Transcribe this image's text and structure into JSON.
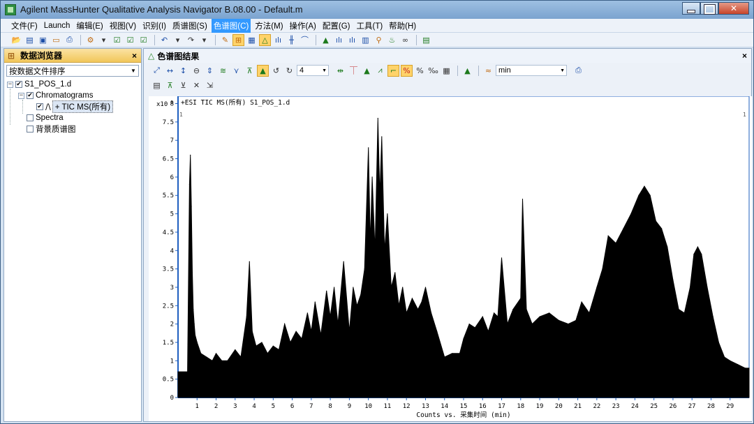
{
  "window": {
    "title": "Agilent MassHunter Qualitative Analysis Navigator B.08.00 - Default.m"
  },
  "menu": [
    "文件(F)",
    "Launch",
    "编辑(E)",
    "视图(V)",
    "识别(I)",
    "质谱图(S)",
    "色谱图(C)",
    "方法(M)",
    "操作(A)",
    "配置(G)",
    "工具(T)",
    "帮助(H)"
  ],
  "menu_active_index": 6,
  "left_panel": {
    "title": "数据浏览器",
    "close": "×",
    "sort_label": "按数据文件排序",
    "tree": {
      "file": "S1_POS_1.d",
      "chromatograms": "Chromatograms",
      "tic": "+ TIC MS(所有)",
      "spectra": "Spectra",
      "background": "背景质谱图"
    }
  },
  "right_panel": {
    "title": "色谱图结果",
    "close": "×",
    "count_value": "4",
    "unit_value": "min"
  },
  "chart_data": {
    "type": "line",
    "title": "+ESI TIC MS(所有) S1_POS_1.d",
    "y_multiplier": "x10",
    "y_exponent": "6",
    "ylim": [
      0,
      8.2
    ],
    "xlim": [
      0,
      30
    ],
    "y_ticks": [
      0,
      0.5,
      1,
      1.5,
      2,
      2.5,
      3,
      3.5,
      4,
      4.5,
      5,
      5.5,
      6,
      6.5,
      7,
      7.5,
      8
    ],
    "y_tick_labels": [
      "0",
      "0.5",
      "1",
      "1.5",
      "2",
      "2.5",
      "3",
      "3.5",
      "4",
      "4.5",
      "5",
      "5.5",
      "6",
      "6.5",
      "7",
      "7.5",
      "8"
    ],
    "x_ticks": [
      1,
      2,
      3,
      4,
      5,
      6,
      7,
      8,
      9,
      10,
      11,
      12,
      13,
      14,
      15,
      16,
      17,
      18,
      19,
      20,
      21,
      22,
      23,
      24,
      25,
      26,
      27,
      28,
      29
    ],
    "x_tick_labels": [
      "1",
      "2",
      "3",
      "4",
      "5",
      "6",
      "7",
      "8",
      "9",
      "10",
      "11",
      "12",
      "13",
      "14",
      "15",
      "16",
      "17",
      "18",
      "19",
      "20",
      "21",
      "22",
      "23",
      "24",
      "25",
      "26",
      "27",
      "28",
      "29"
    ],
    "xlabel": "Counts vs. 采集时间 (min)",
    "corner_labels": [
      "1",
      "1"
    ],
    "series": [
      {
        "color": "#000000",
        "x": [
          0.0,
          0.5,
          0.6,
          0.65,
          0.7,
          0.75,
          0.8,
          0.85,
          0.9,
          1.0,
          1.2,
          1.5,
          1.8,
          2.0,
          2.3,
          2.6,
          3.0,
          3.3,
          3.6,
          3.75,
          3.9,
          4.1,
          4.4,
          4.7,
          5.0,
          5.3,
          5.6,
          5.9,
          6.2,
          6.5,
          6.8,
          7.0,
          7.2,
          7.5,
          7.8,
          8.0,
          8.2,
          8.4,
          8.7,
          9.0,
          9.2,
          9.4,
          9.6,
          9.8,
          10.0,
          10.1,
          10.2,
          10.35,
          10.5,
          10.6,
          10.7,
          10.85,
          11.0,
          11.2,
          11.4,
          11.6,
          11.8,
          12.0,
          12.3,
          12.6,
          12.8,
          13.0,
          13.3,
          13.6,
          14.0,
          14.4,
          14.8,
          15.0,
          15.3,
          15.6,
          16.0,
          16.3,
          16.6,
          16.8,
          17.0,
          17.3,
          17.6,
          18.0,
          18.1,
          18.3,
          18.6,
          19.0,
          19.5,
          20.0,
          20.5,
          20.9,
          21.2,
          21.6,
          22.0,
          22.3,
          22.6,
          23.0,
          23.4,
          23.8,
          24.2,
          24.5,
          24.8,
          25.1,
          25.4,
          25.7,
          26.0,
          26.3,
          26.6,
          26.9,
          27.1,
          27.3,
          27.5,
          27.8,
          28.1,
          28.4,
          28.7,
          29.0,
          29.4,
          29.8,
          30.0
        ],
        "y": [
          0.7,
          0.7,
          5.8,
          6.6,
          5.2,
          3.4,
          2.4,
          2.0,
          1.7,
          1.5,
          1.2,
          1.1,
          1.0,
          1.2,
          1.0,
          1.0,
          1.3,
          1.1,
          2.2,
          3.7,
          1.8,
          1.4,
          1.5,
          1.2,
          1.4,
          1.3,
          2.0,
          1.5,
          1.8,
          1.6,
          2.3,
          1.8,
          2.6,
          1.7,
          2.9,
          2.2,
          3.0,
          2.0,
          3.7,
          1.8,
          3.0,
          2.5,
          2.8,
          3.5,
          6.8,
          4.2,
          6.0,
          4.0,
          7.6,
          5.5,
          7.1,
          4.0,
          5.0,
          3.0,
          3.4,
          2.5,
          3.0,
          2.3,
          2.7,
          2.4,
          2.6,
          3.0,
          2.3,
          1.8,
          1.1,
          1.2,
          1.2,
          1.6,
          2.0,
          1.9,
          2.2,
          1.8,
          2.3,
          2.2,
          3.8,
          2.0,
          2.4,
          2.7,
          5.4,
          2.4,
          2.0,
          2.2,
          2.3,
          2.1,
          2.0,
          2.1,
          2.6,
          2.3,
          3.0,
          3.5,
          4.4,
          4.2,
          4.6,
          5.0,
          5.5,
          5.75,
          5.5,
          4.8,
          4.6,
          4.1,
          3.2,
          2.4,
          2.3,
          3.0,
          3.9,
          4.1,
          3.9,
          3.0,
          2.2,
          1.5,
          1.1,
          1.0,
          0.9,
          0.8,
          0.8
        ]
      }
    ]
  }
}
